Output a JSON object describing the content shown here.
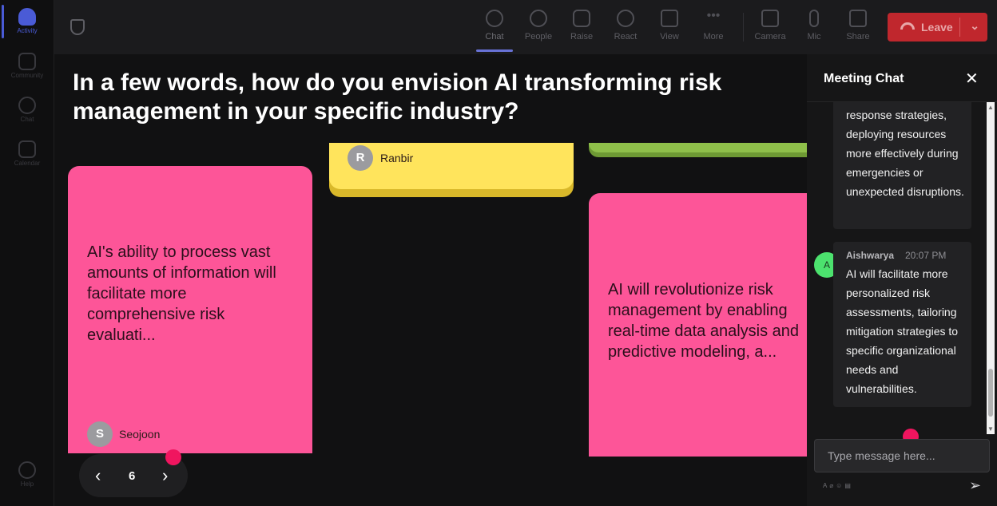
{
  "rail": {
    "items": [
      {
        "label": "Activity",
        "icon": "bell-icon"
      },
      {
        "label": "Community",
        "icon": "community-icon"
      },
      {
        "label": "Chat",
        "icon": "chat-icon"
      },
      {
        "label": "Calendar",
        "icon": "calendar-icon"
      },
      {
        "label": "Help",
        "icon": "help-icon"
      }
    ]
  },
  "toolbar": {
    "items": [
      {
        "label": "Chat",
        "icon": "chat-icon"
      },
      {
        "label": "People",
        "icon": "people-icon"
      },
      {
        "label": "Raise",
        "icon": "hand-icon"
      },
      {
        "label": "React",
        "icon": "smiley-icon"
      },
      {
        "label": "View",
        "icon": "grid-icon"
      },
      {
        "label": "More",
        "icon": "more-icon"
      },
      {
        "label": "Camera",
        "icon": "camera-off-icon"
      },
      {
        "label": "Mic",
        "icon": "mic-icon"
      },
      {
        "label": "Share",
        "icon": "share-icon"
      }
    ],
    "leave_label": "Leave"
  },
  "question": "In a few words, how do you envision AI transforming risk management in your specific industry?",
  "cards": [
    {
      "author_initial": "S",
      "author": "Seojoon",
      "text": "AI's ability to process vast amounts of information will facilitate more comprehensive risk evaluati..."
    },
    {
      "author_initial": "R",
      "author": "Ranbir",
      "text": ""
    },
    {
      "author_initial": "",
      "author": "",
      "text": "AI will revolutionize risk management by enabling real-time data analysis and predictive modeling, a..."
    }
  ],
  "pager": {
    "page": "6",
    "prev": "‹",
    "next": "›"
  },
  "chat": {
    "title": "Meeting Chat",
    "close": "✕",
    "messages": [
      {
        "text": "response strategies, deploying resources more effectively during emergencies or unexpected disruptions."
      },
      {
        "avatar": "A",
        "sender": "Aishwarya",
        "time": "20:07 PM",
        "text": "AI will facilitate more personalized risk assessments, tailoring mitigation strategies to specific organizational needs and vulnerabilities."
      }
    ],
    "input_placeholder": "Type message here...",
    "send": "➢"
  },
  "colors": {
    "accent": "#4a5bd6",
    "leave": "#c0272d",
    "card_pink": "#fd5598",
    "card_yellow": "#ffe45c",
    "card_green": "#8fc04a",
    "record_dot": "#f0155f",
    "chat_avatar": "#4ce26e"
  }
}
